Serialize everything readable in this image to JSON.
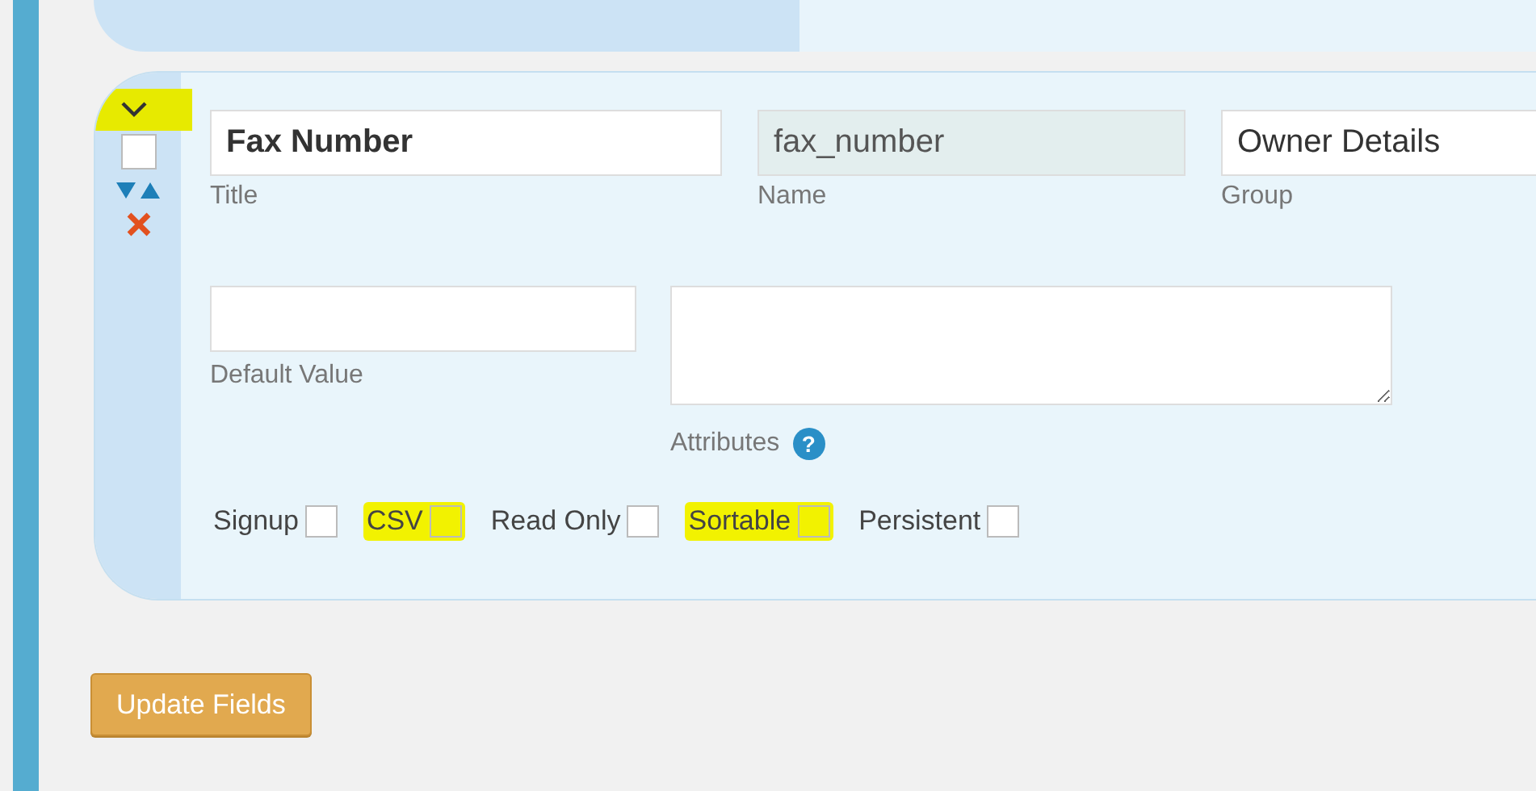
{
  "field": {
    "collapse": {
      "highlighted": true
    },
    "select": {
      "checked": false
    },
    "title": {
      "label": "Title",
      "value": "Fax Number"
    },
    "name": {
      "label": "Name",
      "value": "fax_number",
      "disabled": true
    },
    "group": {
      "label": "Group",
      "value": "Owner Details"
    },
    "default_value": {
      "label": "Default Value"
    },
    "attributes": {
      "label": "Attributes",
      "help": "?"
    },
    "options": [
      {
        "label": "Signup",
        "checked": false,
        "highlighted": false
      },
      {
        "label": "CSV",
        "checked": false,
        "highlighted": true
      },
      {
        "label": "Read Only",
        "checked": false,
        "highlighted": false
      },
      {
        "label": "Sortable",
        "checked": false,
        "highlighted": true
      },
      {
        "label": "Persistent",
        "checked": false,
        "highlighted": false
      }
    ]
  },
  "update_button": {
    "label": "Update Fields"
  }
}
